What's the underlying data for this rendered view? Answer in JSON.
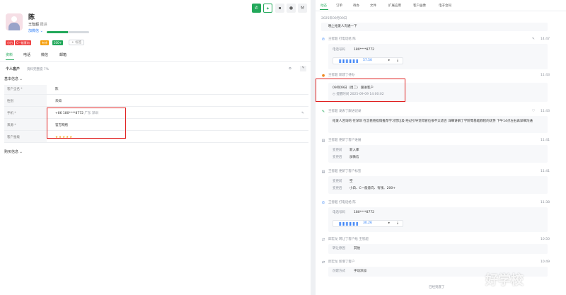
{
  "customer": {
    "name": "陈",
    "owner": "王智超",
    "follow_status": "跟进",
    "add_wechat": "加微信",
    "tags": [
      {
        "label": "小白",
        "color": "#ef4444"
      },
      {
        "label": "C一般意向",
        "color": "#ef4444"
      },
      {
        "label": "有钱",
        "color": "#f59e0b"
      },
      {
        "label": "200+",
        "color": "#22a85a"
      }
    ],
    "add_tag": "+ 标签"
  },
  "left_tabs": [
    "资料",
    "电话",
    "微信",
    "邮箱"
  ],
  "personal": {
    "title": "个人客户",
    "completeness": "资料完整度 7%"
  },
  "basic_info": {
    "title": "基本信息",
    "rows": [
      {
        "label": "客户全名 *",
        "value": "陈"
      },
      {
        "label": "性别",
        "value": "未知"
      },
      {
        "label": "手机 *",
        "value": "+86 180****8772",
        "extra": "广东 深圳"
      },
      {
        "label": "来源 *",
        "value": "官方网络"
      },
      {
        "label": "客户星级",
        "value": "★★★★★"
      }
    ]
  },
  "purchase_info": "购买信息",
  "toolbar": {
    "icons": [
      "phone-icon",
      "sparkle-icon",
      "message-icon",
      "contacts-icon",
      "tools-icon"
    ]
  },
  "right_tabs": [
    "动态",
    "订单",
    "待办",
    "文件",
    "扩展应用",
    "客户画像",
    "电子合同"
  ],
  "timeline": {
    "date": "2025年09月09日",
    "top_note": "晚上给爱人沟通一下",
    "entries": [
      {
        "actor": "王智超",
        "action": "打电话给 陈",
        "time": "14:47",
        "kind": "call",
        "number_label": "电话号码",
        "number": "180****8772",
        "duration": "57.50"
      },
      {
        "actor": "王智超",
        "action": "新建了待办",
        "time": "11:43",
        "kind": "todo",
        "todo_title": "09月09日（周二） 跟进客户",
        "todo_remind": "提醒时间 2025-09-09 14:00:02"
      },
      {
        "actor": "王智超",
        "action": "发表了跟进记录",
        "time": "11:43",
        "kind": "note",
        "text": "给爱人咨询的  在深圳  在念爸爸指情推荐学习营垃圾  经过引导觉得冒位很不太适合  详细讲解了学院零基础教程的优势  下午14点左右再详细沟通"
      },
      {
        "actor": "王智超",
        "action": "更新了客户进展",
        "time": "11:41",
        "kind": "change",
        "before_label": "变更前",
        "before": "新入库",
        "after_label": "变更后",
        "after": "加微信"
      },
      {
        "actor": "王智超",
        "action": "更新了客户标签",
        "time": "11:41",
        "kind": "change",
        "before_label": "变更前",
        "before": "空",
        "after_label": "变更后",
        "after": "小白、C一般意向、有钱、200+"
      },
      {
        "actor": "王智超",
        "action": "打电话给 陈",
        "time": "11:38",
        "kind": "call",
        "number_label": "电话号码",
        "number": "180****8772",
        "duration": "30.26"
      },
      {
        "actor": "邱宏龙",
        "action": "转让了客户给 王智超",
        "time": "10:50",
        "kind": "transfer",
        "label": "转让原因",
        "value": "其他"
      },
      {
        "actor": "邱宏龙",
        "action": "新增了客户",
        "time": "10:49",
        "kind": "create",
        "label": "创建方式",
        "value": "手动添加"
      }
    ],
    "footer": "已经到底了"
  },
  "watermark": "好学校"
}
